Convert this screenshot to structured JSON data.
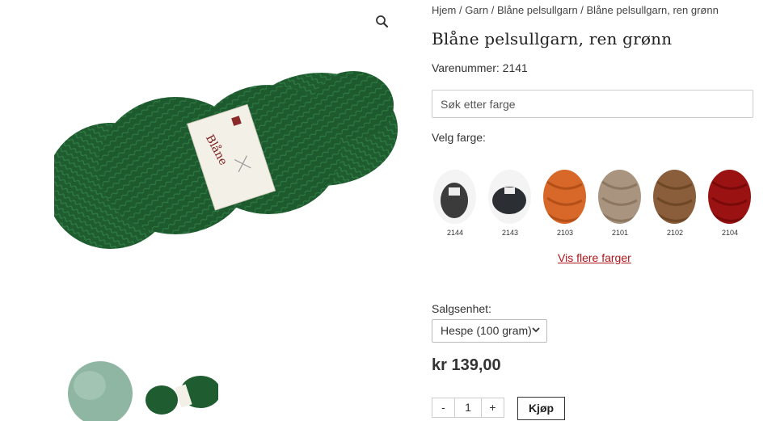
{
  "breadcrumb": {
    "items": [
      "Hjem",
      "Garn",
      "Blåne pelsullgarn",
      "Blåne pelsullgarn, ren grønn"
    ],
    "separator": " / "
  },
  "product": {
    "title": "Blåne pelsullgarn, ren grønn",
    "sku_label": "Varenummer:",
    "sku": "2141",
    "label_band_text": "Blåne",
    "price": "kr 139,00"
  },
  "color_search": {
    "placeholder": "Søk etter farge"
  },
  "color_picker": {
    "label": "Velg farge:",
    "swatches": [
      {
        "code": "2144",
        "color": "#3b3b3b"
      },
      {
        "code": "2143",
        "color": "#2b2f33"
      },
      {
        "code": "2103",
        "color": "#d8682a"
      },
      {
        "code": "2101",
        "color": "#a99480"
      },
      {
        "code": "2102",
        "color": "#8a5e3a"
      },
      {
        "code": "2104",
        "color": "#9b1212"
      }
    ],
    "more_link": "Vis flere farger"
  },
  "sales_unit": {
    "label": "Salgsenhet:",
    "selected": "Hespe (100 gram)"
  },
  "cart": {
    "minus": "-",
    "quantity": "1",
    "plus": "+",
    "buy_label": "Kjøp"
  },
  "gallery": {
    "main_yarn_color": "#1f5c30",
    "thumb_colors": [
      "#8fb6a2",
      "#1f5c30"
    ]
  },
  "icons": {
    "zoom": "magnifier-icon",
    "select": "chevron-down-icon"
  },
  "colors": {
    "accent_link": "#b3161a",
    "border": "#cccccc"
  }
}
